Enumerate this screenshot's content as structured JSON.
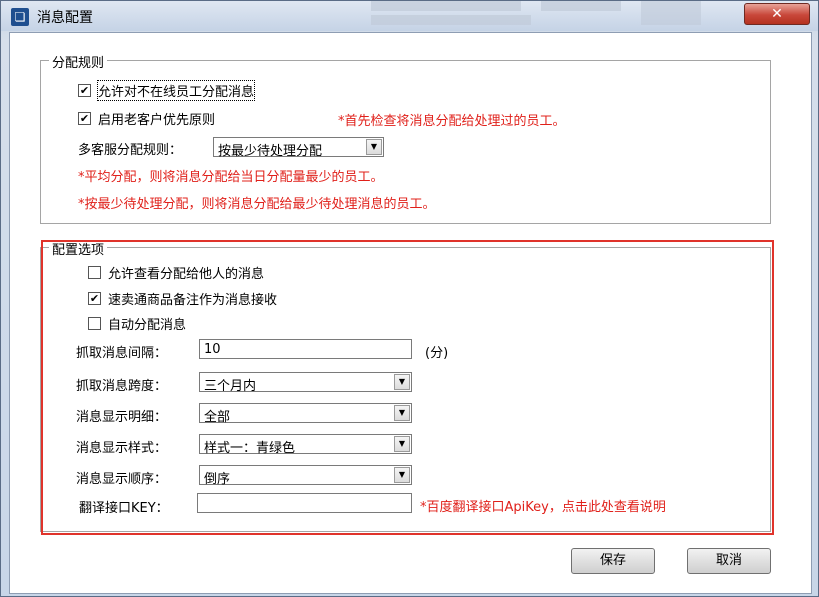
{
  "window": {
    "title": "消息配置",
    "close_glyph": "✕",
    "app_icon": "app-icon"
  },
  "dispatch": {
    "title": "分配规则",
    "allow_offline": {
      "label": "允许对不在线员工分配消息",
      "checked": true
    },
    "old_customer_priority": {
      "label": "启用老客户优先原则",
      "checked": true
    },
    "priority_note": "*首先检查将消息分配给处理过的员工。",
    "multi_rule_label": "多客服分配规则：",
    "multi_rule_value": "按最少待处理分配",
    "note_avg": "*平均分配，则将消息分配给当日分配量最少的员工。",
    "note_min": "*按最少待处理分配，则将消息分配给最少待处理消息的员工。"
  },
  "config": {
    "title": "配置选项",
    "allow_view_others": {
      "label": "允许查看分配给他人的消息",
      "checked": false
    },
    "sell_note": {
      "label": "速卖通商品备注作为消息接收",
      "checked": true
    },
    "auto_assign": {
      "label": "自动分配消息",
      "checked": false
    },
    "interval_label": "抓取消息间隔：",
    "interval_value": "10",
    "interval_unit": "(分)",
    "span_label": "抓取消息跨度：",
    "span_value": "三个月内",
    "detail_label": "消息显示明细：",
    "detail_value": "全部",
    "style_label": "消息显示样式：",
    "style_value": "样式一：青绿色",
    "order_label": "消息显示顺序：",
    "order_value": "倒序",
    "apikey_label": "翻译接口KEY：",
    "apikey_value": "",
    "apikey_note": "*百度翻译接口ApiKey，点击此处查看说明"
  },
  "buttons": {
    "save": "保存",
    "cancel": "取消"
  },
  "colors": {
    "accent_red": "#e0201a",
    "close_red": "#c8473a"
  }
}
